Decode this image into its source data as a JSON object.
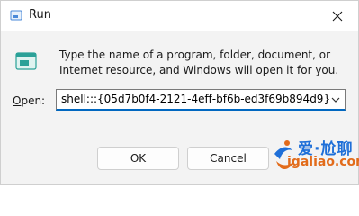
{
  "window": {
    "title": "Run"
  },
  "description": "Type the name of a program, folder, document, or Internet resource, and Windows will open it for you.",
  "open_field": {
    "label_access_key": "O",
    "label_rest": "pen:",
    "value": "shell:::{05d7b0f4-2121-4eff-bf6b-ed3f69b894d9}"
  },
  "buttons": {
    "ok": "OK",
    "cancel": "Cancel"
  },
  "watermark": {
    "line1": "爱·尬聊",
    "line2": "igaliao.com"
  },
  "colors": {
    "accent": "#0067c0",
    "watermark_blue": "#1e6fd8",
    "watermark_orange": "#e26b1a"
  }
}
